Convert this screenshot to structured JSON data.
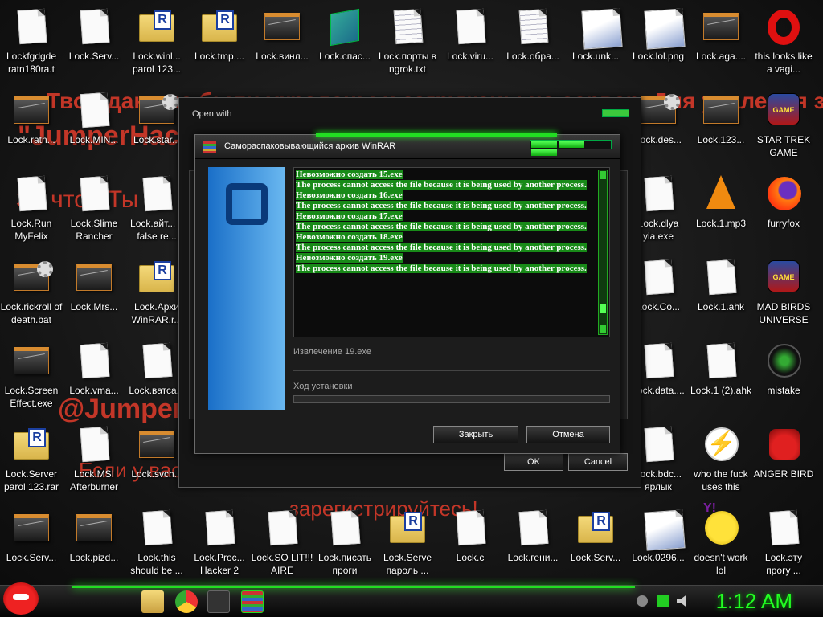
{
  "wallpaper": {
    "lines": [
      "Твои данные были украдены и загружены на сервер. Для удаления зайди на сайт",
      "\"JumperHack\"",
      "За что? Ты че за дела, как ты это?",
      "@JumperHack 8128 вам",
      "Если у вас есть надо скачать и",
      "зарегистрируйтесь!"
    ]
  },
  "desktop_icons": [
    {
      "label": "Lockfgdgde ratn180ra.t",
      "icon": "doc",
      "col": 0,
      "row": 0
    },
    {
      "label": "Lock.Serv...",
      "icon": "doc",
      "col": 1,
      "row": 0
    },
    {
      "label": "Lock.winl... parol 123...",
      "icon": "rar",
      "col": 2,
      "row": 0
    },
    {
      "label": "Lock.tmp....",
      "icon": "rar",
      "col": 3,
      "row": 0
    },
    {
      "label": "Lock.винл...",
      "icon": "win",
      "col": 4,
      "row": 0
    },
    {
      "label": "Lock.спас...",
      "icon": "cube",
      "col": 5,
      "row": 0
    },
    {
      "label": "Lock.порты в ngrok.txt",
      "icon": "doc-lined",
      "col": 6,
      "row": 0
    },
    {
      "label": "Lock.viru...",
      "icon": "doc",
      "col": 7,
      "row": 0
    },
    {
      "label": "Lock.обра...",
      "icon": "doc-lined",
      "col": 8,
      "row": 0
    },
    {
      "label": "Lock.unk...",
      "icon": "doc-img",
      "col": 9,
      "row": 0
    },
    {
      "label": "Lock.lol.png",
      "icon": "doc-img",
      "col": 10,
      "row": 0
    },
    {
      "label": "Lock.aga....",
      "icon": "win",
      "col": 11,
      "row": 0
    },
    {
      "label": "this looks like a vagi...",
      "icon": "opera",
      "col": 12,
      "row": 0
    },
    {
      "label": "Lock.ratn...",
      "icon": "win",
      "col": 0,
      "row": 1
    },
    {
      "label": "Lock.MIN...",
      "icon": "doc",
      "col": 1,
      "row": 1
    },
    {
      "label": "Lock.star...",
      "icon": "win-gear",
      "col": 2,
      "row": 1
    },
    {
      "label": "Lock.des...",
      "icon": "win-gear",
      "col": 10,
      "row": 1
    },
    {
      "label": "Lock.123...",
      "icon": "win",
      "col": 11,
      "row": 1
    },
    {
      "label": "STAR TREK GAME",
      "icon": "game",
      "col": 12,
      "row": 1
    },
    {
      "label": "Lock.Run MyFelix",
      "icon": "doc",
      "col": 0,
      "row": 2
    },
    {
      "label": "Lock.Slime Rancher",
      "icon": "doc",
      "col": 1,
      "row": 2
    },
    {
      "label": "Lock.айт... в false re...",
      "icon": "doc",
      "col": 2,
      "row": 2
    },
    {
      "label": "Lock.dlya yia.exe",
      "icon": "doc",
      "col": 10,
      "row": 2
    },
    {
      "label": "Lock.1.mp3",
      "icon": "vlc",
      "col": 11,
      "row": 2
    },
    {
      "label": "furryfox",
      "icon": "ffox",
      "col": 12,
      "row": 2
    },
    {
      "label": "Lock.rickroll of death.bat",
      "icon": "win-gear",
      "col": 0,
      "row": 3
    },
    {
      "label": "Lock.Mrs...",
      "icon": "win",
      "col": 1,
      "row": 3
    },
    {
      "label": "Lock.Архи WinRAR.r...",
      "icon": "rar",
      "col": 2,
      "row": 3
    },
    {
      "label": "Lock.Co...",
      "icon": "doc",
      "col": 10,
      "row": 3
    },
    {
      "label": "Lock.1.ahk",
      "icon": "doc",
      "col": 11,
      "row": 3
    },
    {
      "label": "MAD BIRDS UNIVERSE",
      "icon": "game",
      "col": 12,
      "row": 3
    },
    {
      "label": "Lock.Screen Effect.exe",
      "icon": "win",
      "col": 0,
      "row": 4
    },
    {
      "label": "Lock.vma...",
      "icon": "doc",
      "col": 1,
      "row": 4
    },
    {
      "label": "Lock.ватса...",
      "icon": "doc",
      "col": 2,
      "row": 4
    },
    {
      "label": "Lock.data....",
      "icon": "doc",
      "col": 10,
      "row": 4
    },
    {
      "label": "Lock.1 (2).ahk",
      "icon": "doc",
      "col": 11,
      "row": 4
    },
    {
      "label": "mistake",
      "icon": "orb",
      "col": 12,
      "row": 4
    },
    {
      "label": "Lock.Server parol 123.rar",
      "icon": "rar",
      "col": 0,
      "row": 5
    },
    {
      "label": "Lock.MSI Afterburner",
      "icon": "doc",
      "col": 1,
      "row": 5
    },
    {
      "label": "Lock.svch...",
      "icon": "win",
      "col": 2,
      "row": 5
    },
    {
      "label": "Lock.bdc... ярлык",
      "icon": "doc",
      "col": 10,
      "row": 5
    },
    {
      "label": "who the fuck uses this",
      "icon": "zap",
      "col": 11,
      "row": 5
    },
    {
      "label": "ANGER BIRD",
      "icon": "bird",
      "col": 12,
      "row": 5
    },
    {
      "label": "Lock.Serv...",
      "icon": "win",
      "col": 0,
      "row": 6
    },
    {
      "label": "Lock.pizd...",
      "icon": "win",
      "col": 1,
      "row": 6
    },
    {
      "label": "Lock.this should be ...",
      "icon": "doc",
      "col": 2,
      "row": 6
    },
    {
      "label": "Lock.Proc... Hacker 2",
      "icon": "doc",
      "col": 3,
      "row": 6
    },
    {
      "label": "Lock.SO LIT!!! AIRE",
      "icon": "doc",
      "col": 4,
      "row": 6
    },
    {
      "label": "Lock.писать проги",
      "icon": "doc",
      "col": 5,
      "row": 6
    },
    {
      "label": "Lock.Serve пароль ...",
      "icon": "rar",
      "col": 6,
      "row": 6
    },
    {
      "label": "Lock.c",
      "icon": "doc",
      "col": 7,
      "row": 6
    },
    {
      "label": "Lock.гени...",
      "icon": "doc",
      "col": 8,
      "row": 6
    },
    {
      "label": "Lock.Serv...",
      "icon": "rar",
      "col": 9,
      "row": 6
    },
    {
      "label": "Lock.0296...",
      "icon": "doc-img",
      "col": 10,
      "row": 6
    },
    {
      "label": "doesn't work lol",
      "icon": "yahoo",
      "col": 11,
      "row": 6
    },
    {
      "label": "Lock.эту прогу ...",
      "icon": "doc",
      "col": 12,
      "row": 6
    }
  ],
  "open_with": {
    "title": "Open with",
    "ok_label": "OK",
    "cancel_label": "Cancel"
  },
  "sfx": {
    "title": "Самораспаковывающийся архив WinRAR",
    "log": [
      "Невозможно создать 15.exe",
      "The process cannot access the file because it is being used by another process.",
      "Невозможно создать 16.exe",
      "The process cannot access the file because it is being used by another process.",
      "Невозможно создать 17.exe",
      "The process cannot access the file because it is being used by another process.",
      "Невозможно создать 18.exe",
      "The process cannot access the file because it is being used by another process.",
      "Невозможно создать 19.exe",
      "The process cannot access the file because it is being used by another process."
    ],
    "status": "Извлечение 19.exe",
    "progress_label": "Ход установки",
    "progress": 0,
    "close_label": "Закрыть",
    "cancel_label": "Отмена"
  },
  "taskbar": {
    "clock": "1:12 AM"
  },
  "colors": {
    "accent": "#22dd22",
    "log_highlight": "#188a18",
    "wallpaper_text": "#d63a2a"
  }
}
